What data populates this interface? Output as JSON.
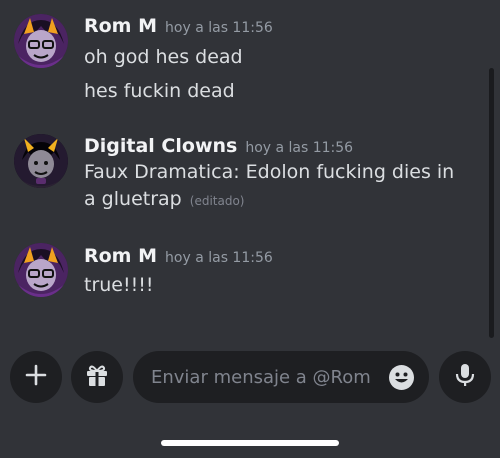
{
  "messages": [
    {
      "username": "Rom M",
      "timestamp": "hoy a las 11:56",
      "avatar": "rom-m-avatar",
      "lines": [
        "oh god hes dead",
        "hes fuckin dead"
      ]
    },
    {
      "username": "Digital Clowns",
      "timestamp": "hoy a las 11:56",
      "avatar": "digital-clowns-avatar",
      "text": "Faux Dramatica: Edolon fucking dies in a gluetrap",
      "edited": "(editado)"
    },
    {
      "username": "Rom M",
      "timestamp": "hoy a las 11:56",
      "avatar": "rom-m-avatar",
      "lines": [
        "true!!!!"
      ]
    }
  ],
  "composer": {
    "placeholder": "Enviar mensaje a @Rom M",
    "icons": [
      "plus-icon",
      "gift-icon",
      "emoji-icon",
      "microphone-icon"
    ]
  },
  "colors": {
    "background": "#313338",
    "input_background": "#1e1f22",
    "username": "#f2f3f5",
    "message_text": "#dbdee1",
    "timestamp": "#949ba4"
  }
}
